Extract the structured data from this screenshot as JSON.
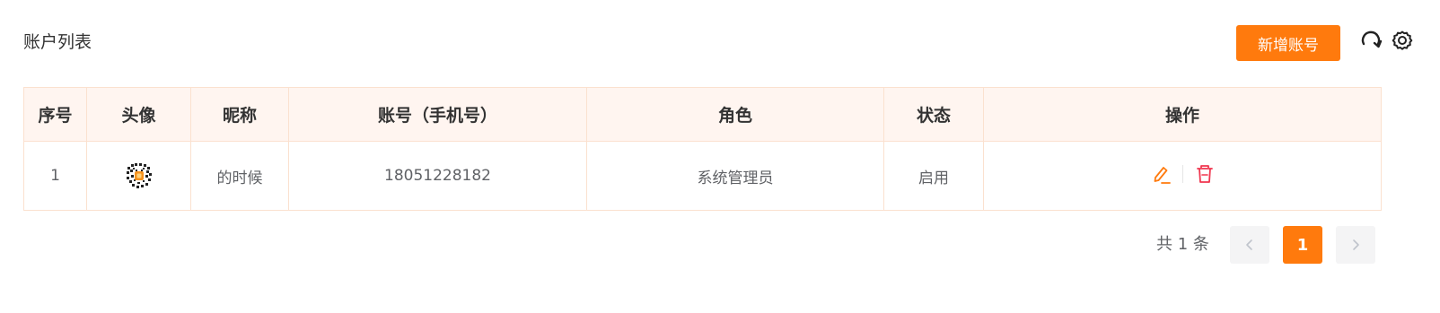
{
  "header": {
    "title": "账户列表",
    "add_button_label": "新增账号",
    "refresh_icon": "refresh-icon",
    "settings_icon": "settings-gear-icon"
  },
  "table": {
    "columns": [
      "序号",
      "头像",
      "昵称",
      "账号（手机号）",
      "角色",
      "状态",
      "操作"
    ],
    "rows": [
      {
        "index": "1",
        "avatar": "qr-code-avatar",
        "nickname": "的时候",
        "account": "18051228182",
        "role": "系统管理员",
        "status": "启用",
        "actions": [
          "edit-icon",
          "delete-icon"
        ]
      }
    ]
  },
  "pagination": {
    "total_text": "共 1 条",
    "current_page": "1",
    "prev_symbol": "‹",
    "next_symbol": "›"
  },
  "colors": {
    "accent": "#ff7a0d",
    "status_enabled": "#22b14c",
    "delete": "#f0364f",
    "header_bg": "#fff5f0",
    "border": "#fbe1cf"
  }
}
